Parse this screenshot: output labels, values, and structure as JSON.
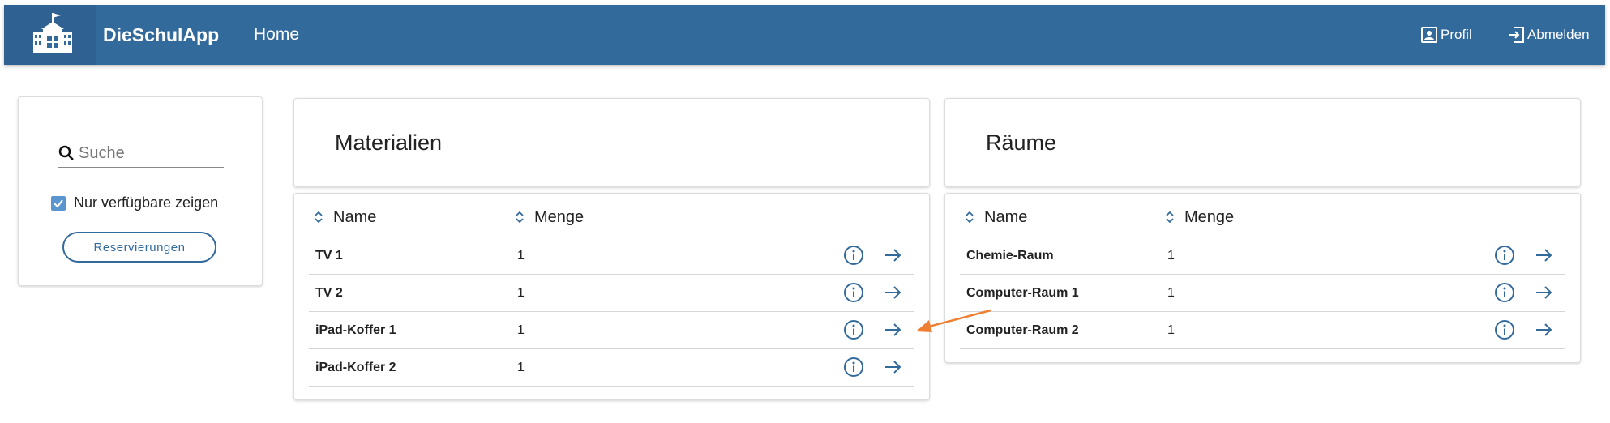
{
  "header": {
    "brand": "DieSchulApp",
    "nav_home": "Home",
    "profile_label": "Profil",
    "logout_label": "Abmelden"
  },
  "filter": {
    "search_placeholder": "Suche",
    "only_available_label": "Nur verfügbare zeigen",
    "only_available_checked": true,
    "reservations_button": "Reservierungen"
  },
  "materials": {
    "title": "Materialien",
    "columns": [
      "Name",
      "Menge"
    ],
    "rows": [
      {
        "name": "TV 1",
        "qty": "1"
      },
      {
        "name": "TV 2",
        "qty": "1"
      },
      {
        "name": "iPad-Koffer 1",
        "qty": "1"
      },
      {
        "name": "iPad-Koffer 2",
        "qty": "1"
      }
    ]
  },
  "rooms": {
    "title": "Räume",
    "columns": [
      "Name",
      "Menge"
    ],
    "rows": [
      {
        "name": "Chemie-Raum",
        "qty": "1"
      },
      {
        "name": "Computer-Raum 1",
        "qty": "1"
      },
      {
        "name": "Computer-Raum 2",
        "qty": "1"
      }
    ]
  },
  "colors": {
    "header_bg": "#336a9c",
    "accent": "#336a9c",
    "checkbox": "#5b95cf",
    "annotation_arrow": "#ee7f33"
  },
  "icons": [
    "school-logo-icon",
    "profile-icon",
    "logout-icon",
    "search-icon",
    "check-icon",
    "sort-icon",
    "info-icon",
    "arrow-right-icon"
  ]
}
